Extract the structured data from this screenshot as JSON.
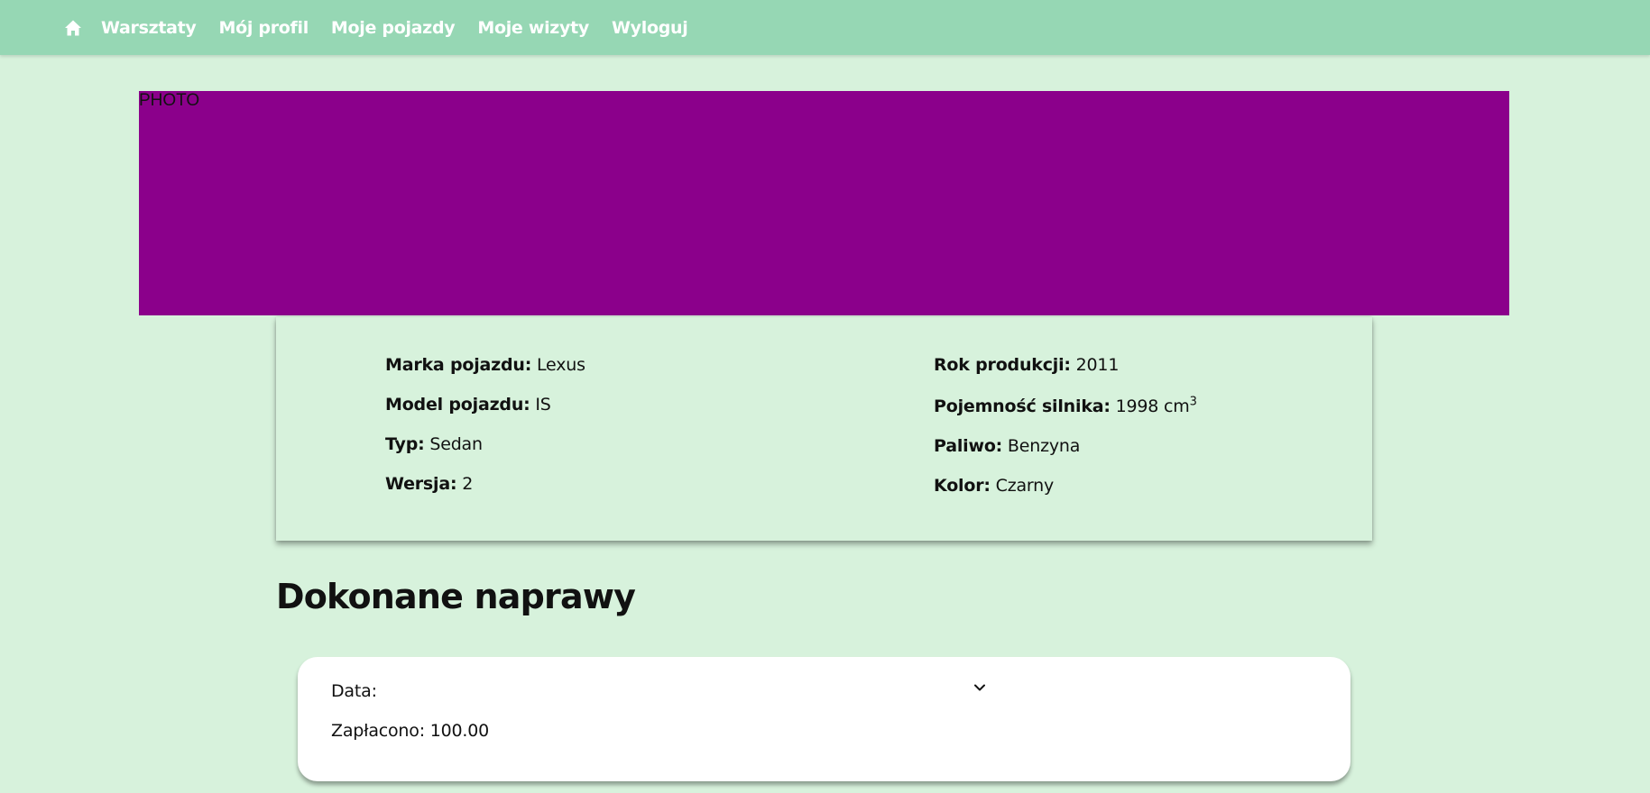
{
  "nav": {
    "home_icon": "home-icon",
    "links": [
      "Warsztaty",
      "Mój profil",
      "Moje pojazdy",
      "Moje wizyty",
      "Wyloguj"
    ]
  },
  "photo": {
    "label": "PHOTO",
    "color": "#8b008b"
  },
  "vehicle": {
    "left": [
      {
        "label": "Marka pojazdu:",
        "value": "Lexus"
      },
      {
        "label": "Model pojazdu:",
        "value": "IS"
      },
      {
        "label": "Typ:",
        "value": "Sedan"
      },
      {
        "label": "Wersja:",
        "value": "2"
      }
    ],
    "right": [
      {
        "label": "Rok produkcji:",
        "value": "2011"
      },
      {
        "label": "Pojemność silnika:",
        "value": "1998 cm",
        "sup": "3"
      },
      {
        "label": "Paliwo:",
        "value": "Benzyna"
      },
      {
        "label": "Kolor:",
        "value": "Czarny"
      }
    ]
  },
  "repairs": {
    "title": "Dokonane naprawy",
    "items": [
      {
        "date_label": "Data:",
        "paid_text": "Zapłacono: 100.00",
        "expand_icon": "chevron-down-icon"
      }
    ]
  },
  "colors": {
    "navbar": "#96d7b4",
    "background": "#d7f2dc",
    "card": "#ffffff"
  }
}
